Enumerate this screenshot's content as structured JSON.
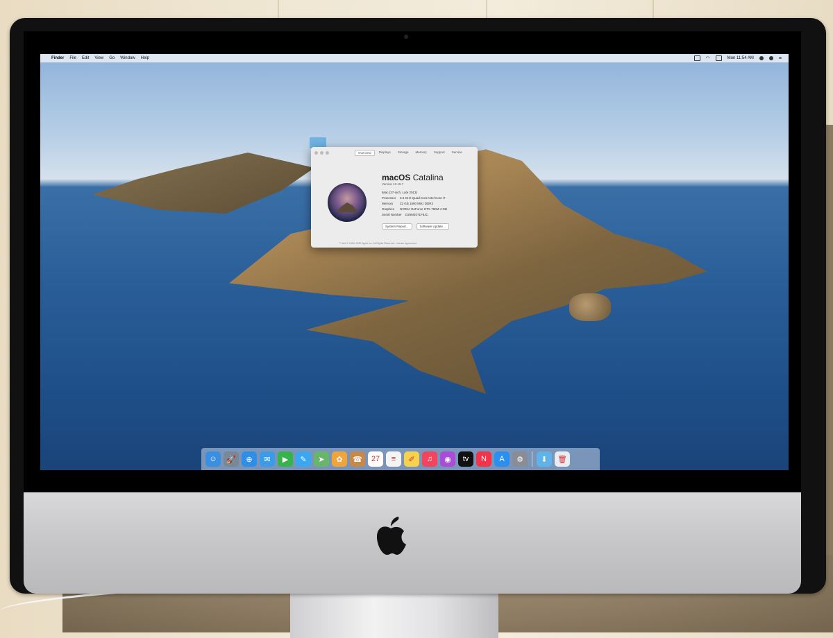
{
  "menubar": {
    "apple_glyph": "",
    "items": [
      "Finder",
      "File",
      "Edit",
      "View",
      "Go",
      "Window",
      "Help"
    ],
    "clock": "Mon 11:54 AM"
  },
  "about_window": {
    "tabs": [
      "Overview",
      "Displays",
      "Storage",
      "Memory",
      "Support",
      "Service"
    ],
    "active_tab": "Overview",
    "os_name_bold": "macOS",
    "os_name_rest": " Catalina",
    "version": "Version 10.15.7",
    "model": "iMac (27-inch, Late 2013)",
    "specs": [
      {
        "key": "Processor",
        "value": "3.5 GHz Quad-Core Intel Core i7"
      },
      {
        "key": "Memory",
        "value": "32 GB 1600 MHz DDR3"
      },
      {
        "key": "Graphics",
        "value": "NVIDIA GeForce GTX 780M 4 GB"
      },
      {
        "key": "Serial Number",
        "value": "D25M4071F8JC"
      }
    ],
    "buttons": {
      "system_report": "System Report...",
      "software_update": "Software Update..."
    },
    "copyright": "™ and © 1983–2020 Apple Inc. All Rights Reserved. License Agreement"
  },
  "dock": {
    "apps": [
      {
        "name": "finder-icon",
        "glyph": "☺",
        "color": "#3b8fe0"
      },
      {
        "name": "launchpad-icon",
        "glyph": "🚀",
        "color": "#7a8797"
      },
      {
        "name": "safari-icon",
        "glyph": "⊕",
        "color": "#2f8ee6"
      },
      {
        "name": "mail-icon",
        "glyph": "✉",
        "color": "#3c9be8"
      },
      {
        "name": "facetime-icon",
        "glyph": "▶",
        "color": "#38b24a"
      },
      {
        "name": "messages-icon",
        "glyph": "✎",
        "color": "#3aa8f0"
      },
      {
        "name": "maps-icon",
        "glyph": "➤",
        "color": "#69b56b"
      },
      {
        "name": "photos-icon",
        "glyph": "✿",
        "color": "#f0a53c"
      },
      {
        "name": "contacts-icon",
        "glyph": "☎",
        "color": "#c7894a"
      },
      {
        "name": "calendar-icon",
        "glyph": "27",
        "color": "#ffffff"
      },
      {
        "name": "reminders-icon",
        "glyph": "≡",
        "color": "#f4f4f4"
      },
      {
        "name": "notes-icon",
        "glyph": "✐",
        "color": "#f7d24c"
      },
      {
        "name": "music-icon",
        "glyph": "♫",
        "color": "#f2445c"
      },
      {
        "name": "podcasts-icon",
        "glyph": "◉",
        "color": "#a94dd6"
      },
      {
        "name": "tv-icon",
        "glyph": "tv",
        "color": "#111111"
      },
      {
        "name": "news-icon",
        "glyph": "N",
        "color": "#f2334a"
      },
      {
        "name": "app-store-icon",
        "glyph": "A",
        "color": "#2b8ff0"
      },
      {
        "name": "system-preferences-icon",
        "glyph": "⚙",
        "color": "#8a8d93"
      }
    ],
    "right": [
      {
        "name": "downloads-folder-icon",
        "glyph": "⬇",
        "color": "#5fb3e8"
      },
      {
        "name": "trash-icon",
        "glyph": "🗑",
        "color": "#e9edf1"
      }
    ]
  }
}
